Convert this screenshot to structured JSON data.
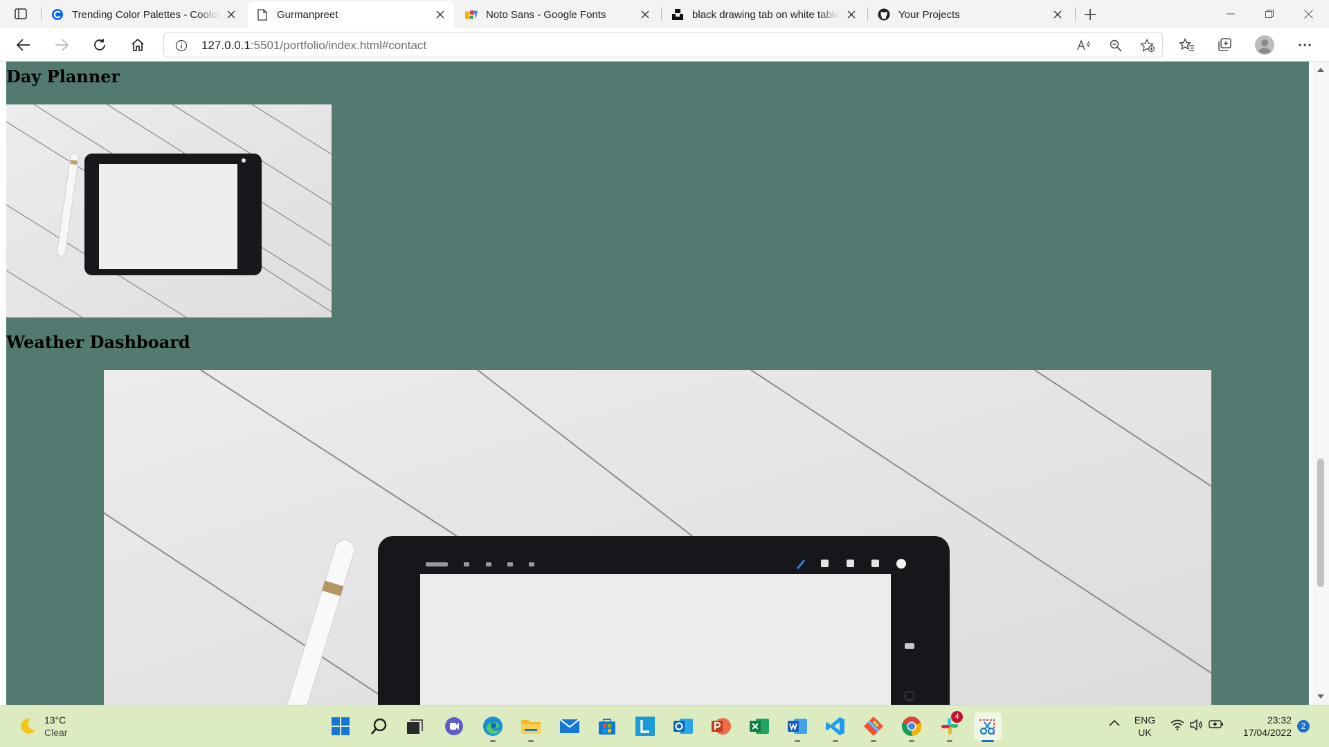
{
  "browser": {
    "tabs": [
      {
        "title": "Trending Color Palettes - Coolors",
        "favicon": "coolors-icon",
        "active": false
      },
      {
        "title": "Gurmanpreet",
        "favicon": "page-icon",
        "active": true
      },
      {
        "title": "Noto Sans - Google Fonts",
        "favicon": "google-fonts-icon",
        "active": false
      },
      {
        "title": "black drawing tab on white table",
        "favicon": "unsplash-icon",
        "active": false
      },
      {
        "title": "Your Projects",
        "favicon": "github-icon",
        "active": false
      }
    ],
    "address": {
      "host": "127.0.0.1",
      "rest": ":5501/portfolio/index.html#contact"
    }
  },
  "page": {
    "background": "#527a71",
    "projects": [
      {
        "title": "Day Planner"
      },
      {
        "title": "Weather Dashboard"
      }
    ]
  },
  "taskbar": {
    "weather": {
      "temp": "13°C",
      "condition": "Clear"
    },
    "apps": [
      "start",
      "search",
      "task-view",
      "teams-chat",
      "edge",
      "file-explorer",
      "mail",
      "store",
      "lexicon",
      "outlook",
      "powerpoint",
      "excel",
      "word",
      "vscode",
      "git",
      "chrome",
      "slack",
      "snipping-tool"
    ],
    "slack_badge": "4",
    "language": {
      "line1": "ENG",
      "line2": "UK"
    },
    "clock": {
      "time": "23:32",
      "date": "17/04/2022"
    },
    "notification_count": "2"
  }
}
